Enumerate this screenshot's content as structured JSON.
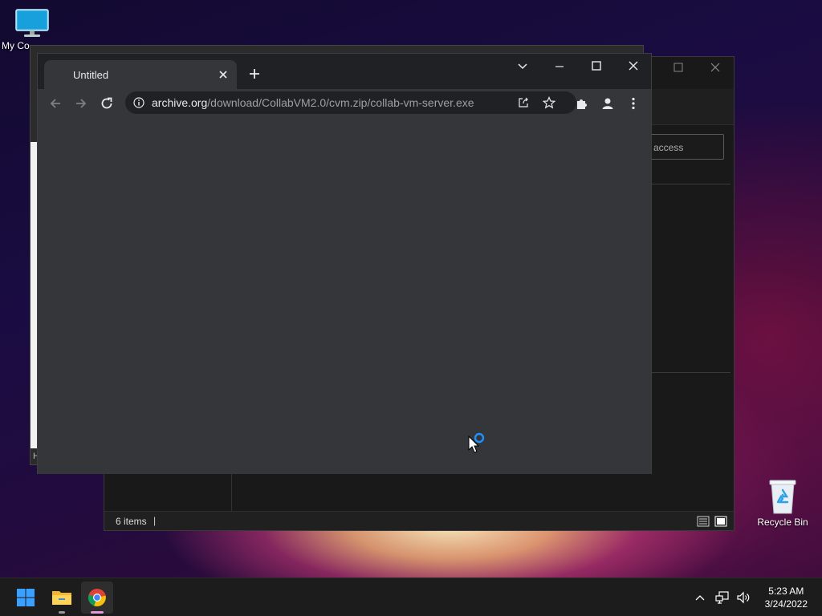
{
  "desktop": {
    "icons": [
      {
        "label": "My Co"
      },
      {
        "label": "Recycle Bin"
      }
    ]
  },
  "background_window": {
    "search_placeholder": "access",
    "status_items": "6 items",
    "status_cursor": "|"
  },
  "left_window": {
    "bottom_text": "H"
  },
  "browser": {
    "tab": {
      "title": "Untitled"
    },
    "address": {
      "domain": "archive.org",
      "path": "/download/CollabVM2.0/cvm.zip/collab-vm-server.exe"
    }
  },
  "taskbar": {
    "time": "5:23 AM",
    "date": "3/24/2022"
  },
  "colors": {
    "accent": "#0078d4",
    "chrome_frame": "#202124",
    "chrome_toolbar": "#35363a"
  }
}
